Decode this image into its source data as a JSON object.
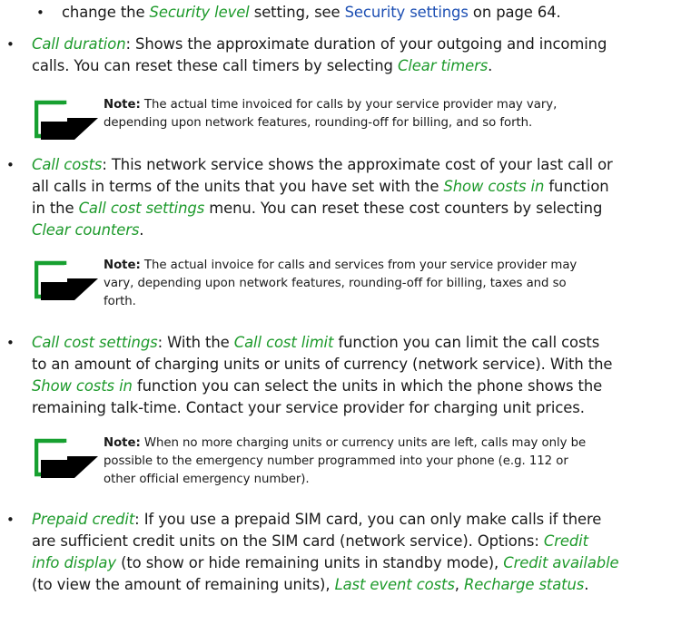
{
  "top_item": {
    "prefix": "change the ",
    "term": "Security level",
    "middle": " setting, see ",
    "link": "Security settings",
    "suffix": " on page 64."
  },
  "call_duration": {
    "term": "Call duration",
    "line1_rest": ": Shows the approximate duration of your outgoing and incoming",
    "line2_start": "calls. You can reset these call timers by selecting ",
    "line2_term": "Clear timers",
    "line2_end": "."
  },
  "note1": {
    "label": "Note:",
    "line1": " The actual time invoiced for calls by your service provider may vary,",
    "line2": "depending upon network features, rounding-off for billing, and so forth."
  },
  "call_costs": {
    "term": "Call costs",
    "line1_rest": ": This network service shows the approximate cost of your last call or",
    "line2_start": "all calls in terms of the units that you have set with the ",
    "line2_term": "Show costs in",
    "line2_end": " function",
    "line3_start": "in the ",
    "line3_term": "Call cost settings",
    "line3_end": " menu. You can reset these cost counters by selecting",
    "line4_term": "Clear counters",
    "line4_end": "."
  },
  "note2": {
    "label": "Note:",
    "line1": " The actual invoice for calls and services from your service provider may",
    "line2": "vary, depending upon network features, rounding-off for billing, taxes and so",
    "line3": "forth."
  },
  "call_cost_settings": {
    "term": "Call cost settings",
    "line1_mid": ": With the ",
    "line1_term": "Call cost limit",
    "line1_end": " function you can limit the call costs",
    "line2": "to an amount of charging units or units of currency (network service). With the",
    "line3_term": "Show costs in",
    "line3_end": " function you can select the units in which the phone shows the",
    "line4": "remaining talk-time. Contact your service provider for charging unit prices."
  },
  "note3": {
    "label": "Note:",
    "line1": " When no more charging units or currency units are left, calls may only be",
    "line2": "possible to the emergency number programmed into your phone (e.g. 112 or",
    "line3": "other official emergency number)."
  },
  "prepaid_credit": {
    "term": "Prepaid credit",
    "line1_rest": ": If you use a prepaid SIM card, you can only make calls if there",
    "line2_start": "are sufficient credit units on the SIM card (network service). Options: ",
    "line2_term": "Credit",
    "line3_term": "info display",
    "line3_mid": " (to show or hide remaining units in standby mode), ",
    "line3_term2": "Credit available",
    "line4_start": "(to view the amount of remaining units), ",
    "line4_term": "Last event costs",
    "line4_sep": ", ",
    "line4_term2": "Recharge status",
    "line4_end": "."
  },
  "icon_name": "note-hand-icon",
  "colors": {
    "term": "#1d9a2b",
    "link": "#1d4fb3",
    "icon": "#17a030"
  }
}
